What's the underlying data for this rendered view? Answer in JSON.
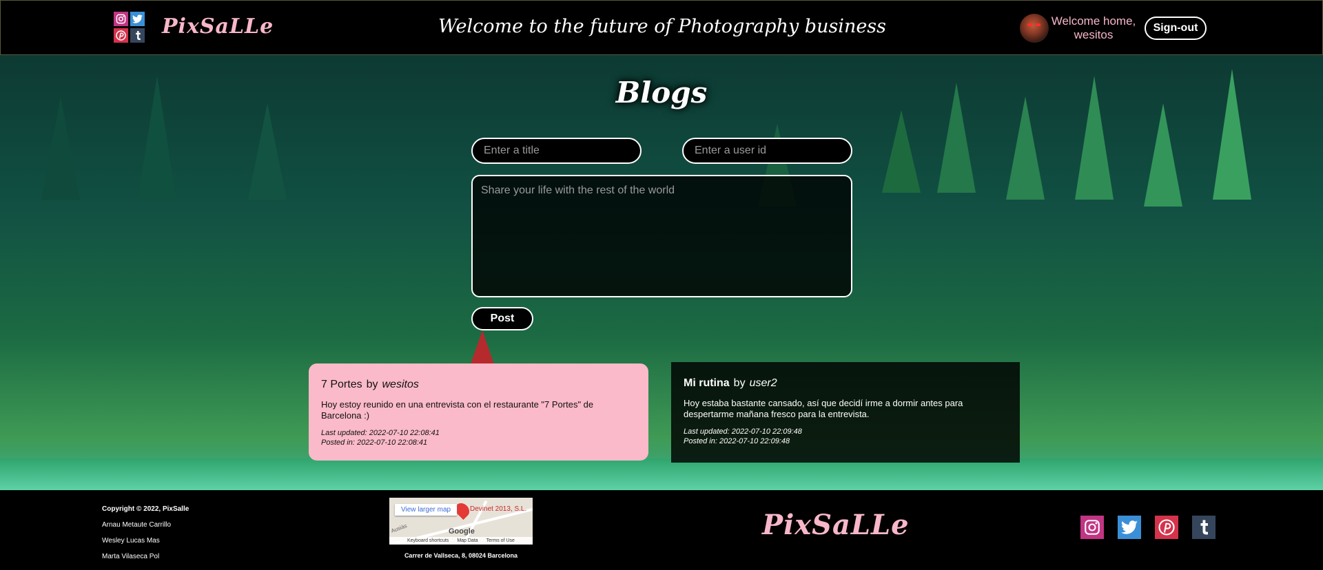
{
  "header": {
    "brand": "PixSaLLe",
    "title": "Welcome to the future of Photography business",
    "welcome_line1": "Welcome home,",
    "welcome_line2": "wesitos",
    "signout_label": "Sign-out",
    "social_icons": [
      "instagram-icon",
      "twitter-icon",
      "pinterest-icon",
      "tumblr-icon"
    ]
  },
  "main": {
    "heading": "Blogs",
    "form": {
      "title_placeholder": "Enter a title",
      "title_value": "",
      "userid_placeholder": "Enter a user id",
      "userid_value": "",
      "body_placeholder": "Share your life with the rest of the world",
      "body_value": "",
      "post_label": "Post"
    },
    "posts": [
      {
        "title": "7 Portes",
        "by": "by",
        "author": "wesitos",
        "body": "Hoy estoy reunido en una entrevista con el restaurante \"7 Portes\" de Barcelona :)",
        "updated": "Last updated: 2022-07-10 22:08:41",
        "posted": "Posted in: 2022-07-10 22:08:41",
        "bg": "#fbbac9"
      },
      {
        "title": "Mi rutina",
        "by": "by",
        "author": "user2",
        "body": "Hoy estaba bastante cansado, así que decidí irme a dormir antes para despertarme mañana fresco para la entrevista.",
        "updated": "Last updated: 2022-07-10 22:09:48",
        "posted": "Posted in: 2022-07-10 22:09:48",
        "bg": "#000000"
      }
    ]
  },
  "footer": {
    "copyright": "Copyright © 2022, PixSalle",
    "authors": [
      "Arnau Metaute Carrillo",
      "Wesley Lucas Mas",
      "Marta Vilaseca Pol"
    ],
    "map": {
      "larger_link": "View larger map",
      "place": "Devinet 2013, S.L.",
      "google": "Google",
      "street": "Ausiàs",
      "shortcuts": "Keyboard shortcuts",
      "map_data": "Map Data",
      "terms": "Terms of Use"
    },
    "address": "Carrer de Vallseca, 8, 08024 Barcelona",
    "brand": "PixSaLLe",
    "social_icons": [
      "instagram-icon",
      "twitter-icon",
      "pinterest-icon",
      "tumblr-icon"
    ]
  },
  "colors": {
    "accent_pink": "#f7b7c9",
    "card_pink": "#fbbac9",
    "instagram": "#c13584",
    "twitter": "#3b8fd6",
    "pinterest": "#d5334c",
    "tumblr": "#35465c"
  }
}
